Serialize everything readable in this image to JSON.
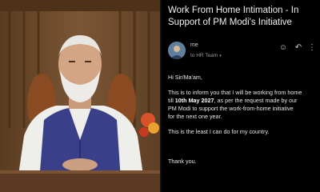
{
  "email": {
    "subject": "Work From Home Intimation - In Support of PM Modi's Initiative",
    "sender": "me",
    "recipient": "to HR Team",
    "greeting": "Hi Sir/Ma'am,",
    "body_line_1": "This is to inform you that I will be working from home",
    "body_line_2_prefix": "till",
    "body_line_2_date": "10th May 2027",
    "body_line_2_suffix": ", as per the request made by our",
    "body_line_3": "PM Modi to support the work-from-home initiative",
    "body_line_4": "for the next one year.",
    "closing_line": "This is the least I can do for my country.",
    "sign_off": "Thank you."
  },
  "icons": {
    "emoji": "smiley-icon",
    "reply": "reply-icon",
    "more": "more-vertical-icon"
  },
  "colors": {
    "email_background": "#000000",
    "text": "#e6e6e6",
    "curtain": "#6b4a2c"
  }
}
